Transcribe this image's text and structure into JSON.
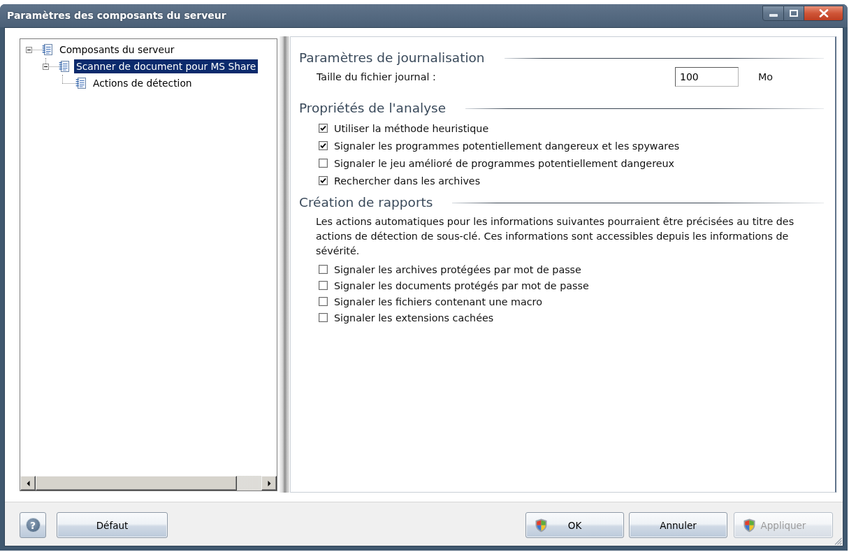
{
  "window": {
    "title": "Paramètres des composants du serveur"
  },
  "tree": {
    "items": [
      {
        "label": "Composants du serveur",
        "expanded": true,
        "selected": false,
        "children": [
          {
            "label": "Scanner de document pour MS Share",
            "expanded": true,
            "selected": true,
            "children": [
              {
                "label": "Actions de détection",
                "selected": false
              }
            ]
          }
        ]
      }
    ]
  },
  "settings": {
    "sections": [
      {
        "kind": "fields",
        "title": "Paramètres de journalisation",
        "fields": [
          {
            "label": "Taille du fichier journal :",
            "value": "100",
            "unit": "Mo"
          }
        ]
      },
      {
        "kind": "options",
        "title": "Propriétés de l'analyse",
        "options": [
          {
            "label": "Utiliser la méthode heuristique",
            "checked": true
          },
          {
            "label": "Signaler les programmes potentiellement dangereux et les spywares",
            "checked": true
          },
          {
            "label": "Signaler le jeu amélioré de programmes potentiellement dangereux",
            "checked": false
          },
          {
            "label": "Rechercher dans les archives",
            "checked": true
          }
        ]
      },
      {
        "kind": "options",
        "title": "Création de rapports",
        "description": "Les actions automatiques pour les informations suivantes pourraient être précisées au titre des actions de détection de sous-clé. Ces informations sont accessibles depuis les informations de sévérité.",
        "options": [
          {
            "label": "Signaler les archives protégées par mot de passe",
            "checked": false
          },
          {
            "label": "Signaler les documents protégés par mot de passe",
            "checked": false
          },
          {
            "label": "Signaler les fichiers contenant une macro",
            "checked": false
          },
          {
            "label": "Signaler les extensions cachées",
            "checked": false
          }
        ]
      }
    ]
  },
  "footer": {
    "help_button": {
      "symbol": "?"
    },
    "left_buttons": [
      {
        "label": "Défaut",
        "shield": false,
        "disabled": false
      }
    ],
    "right_buttons": [
      {
        "label": "OK",
        "shield": true,
        "disabled": false
      },
      {
        "label": "Annuler",
        "shield": false,
        "disabled": false
      },
      {
        "label": "Appliquer",
        "shield": true,
        "disabled": true
      }
    ]
  }
}
